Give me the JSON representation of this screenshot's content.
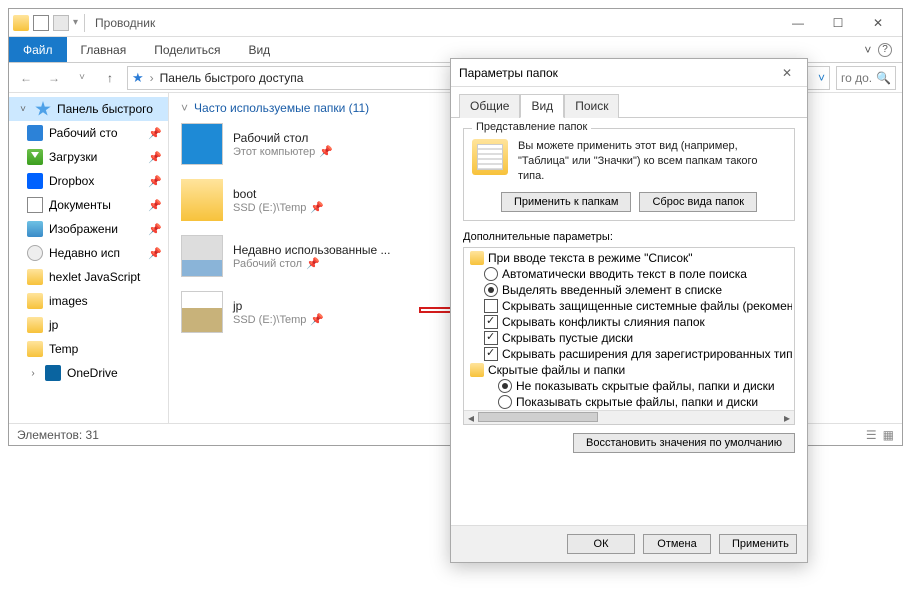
{
  "explorer": {
    "title": "Проводник",
    "ribbon": {
      "file": "Файл",
      "tabs": [
        "Главная",
        "Поделиться",
        "Вид"
      ]
    },
    "address": {
      "crumb": "Панель быстрого доступа",
      "search_placeholder": "го до..."
    },
    "sidebar": [
      {
        "name": "Панель быстрого",
        "icon": "star",
        "top": true,
        "expandable": true
      },
      {
        "name": "Рабочий сто",
        "icon": "desktop",
        "pin": true
      },
      {
        "name": "Загрузки",
        "icon": "down",
        "pin": true
      },
      {
        "name": "Dropbox",
        "icon": "dropbox",
        "pin": true
      },
      {
        "name": "Документы",
        "icon": "docs",
        "pin": true
      },
      {
        "name": "Изображени",
        "icon": "img",
        "pin": true
      },
      {
        "name": "Недавно исп",
        "icon": "recent",
        "pin": true
      },
      {
        "name": "hexlet JavaScript",
        "icon": "folder"
      },
      {
        "name": "images",
        "icon": "folder"
      },
      {
        "name": "jp",
        "icon": "folder"
      },
      {
        "name": "Temp",
        "icon": "folder"
      },
      {
        "name": "OneDrive",
        "icon": "onedrive",
        "expandable": true
      }
    ],
    "content_header": "Часто используемые папки (11)",
    "files": [
      {
        "name": "Рабочий стол",
        "path": "Этот компьютер",
        "thumb": "desktop",
        "pin": true
      },
      {
        "name": "boot",
        "path": "SSD (E:)\\Temp",
        "thumb": "folder",
        "pin": true
      },
      {
        "name": "Недавно использованные ...",
        "path": "Рабочий стол",
        "thumb": "recent",
        "pin": true
      },
      {
        "name": "jp",
        "path": "SSD (E:)\\Temp",
        "thumb": "jp",
        "pin": true
      }
    ],
    "status": "Элементов: 31"
  },
  "dialog": {
    "title": "Параметры папок",
    "tabs": [
      "Общие",
      "Вид",
      "Поиск"
    ],
    "active_tab": 1,
    "group": {
      "legend": "Представление папок",
      "text": "Вы можете применить этот вид (например, \"Таблица\" или \"Значки\") ко всем папкам такого типа.",
      "apply_btn": "Применить к папкам",
      "reset_btn": "Сброс вида папок"
    },
    "adv_label": "Дополнительные параметры:",
    "adv_items": [
      {
        "type": "folder",
        "label": "При вводе текста в режиме \"Список\""
      },
      {
        "type": "radio",
        "label": "Автоматически вводить текст в поле поиска",
        "checked": false
      },
      {
        "type": "radio",
        "label": "Выделять введенный элемент в списке",
        "checked": true
      },
      {
        "type": "check",
        "label": "Скрывать защищенные системные файлы (рекомен",
        "checked": false,
        "highlighted": true
      },
      {
        "type": "check",
        "label": "Скрывать конфликты слияния папок",
        "checked": true
      },
      {
        "type": "check",
        "label": "Скрывать пустые диски",
        "checked": true
      },
      {
        "type": "check",
        "label": "Скрывать расширения для зарегистрированных типо",
        "checked": true
      },
      {
        "type": "folder",
        "label": "Скрытые файлы и папки"
      },
      {
        "type": "radio",
        "label": "Не показывать скрытые файлы, папки и диски",
        "checked": true,
        "sub2": true
      },
      {
        "type": "radio",
        "label": "Показывать скрытые файлы, папки и диски",
        "checked": false,
        "sub2": true
      }
    ],
    "restore_btn": "Восстановить значения по умолчанию",
    "ok": "ОК",
    "cancel": "Отмена",
    "apply": "Применить"
  }
}
